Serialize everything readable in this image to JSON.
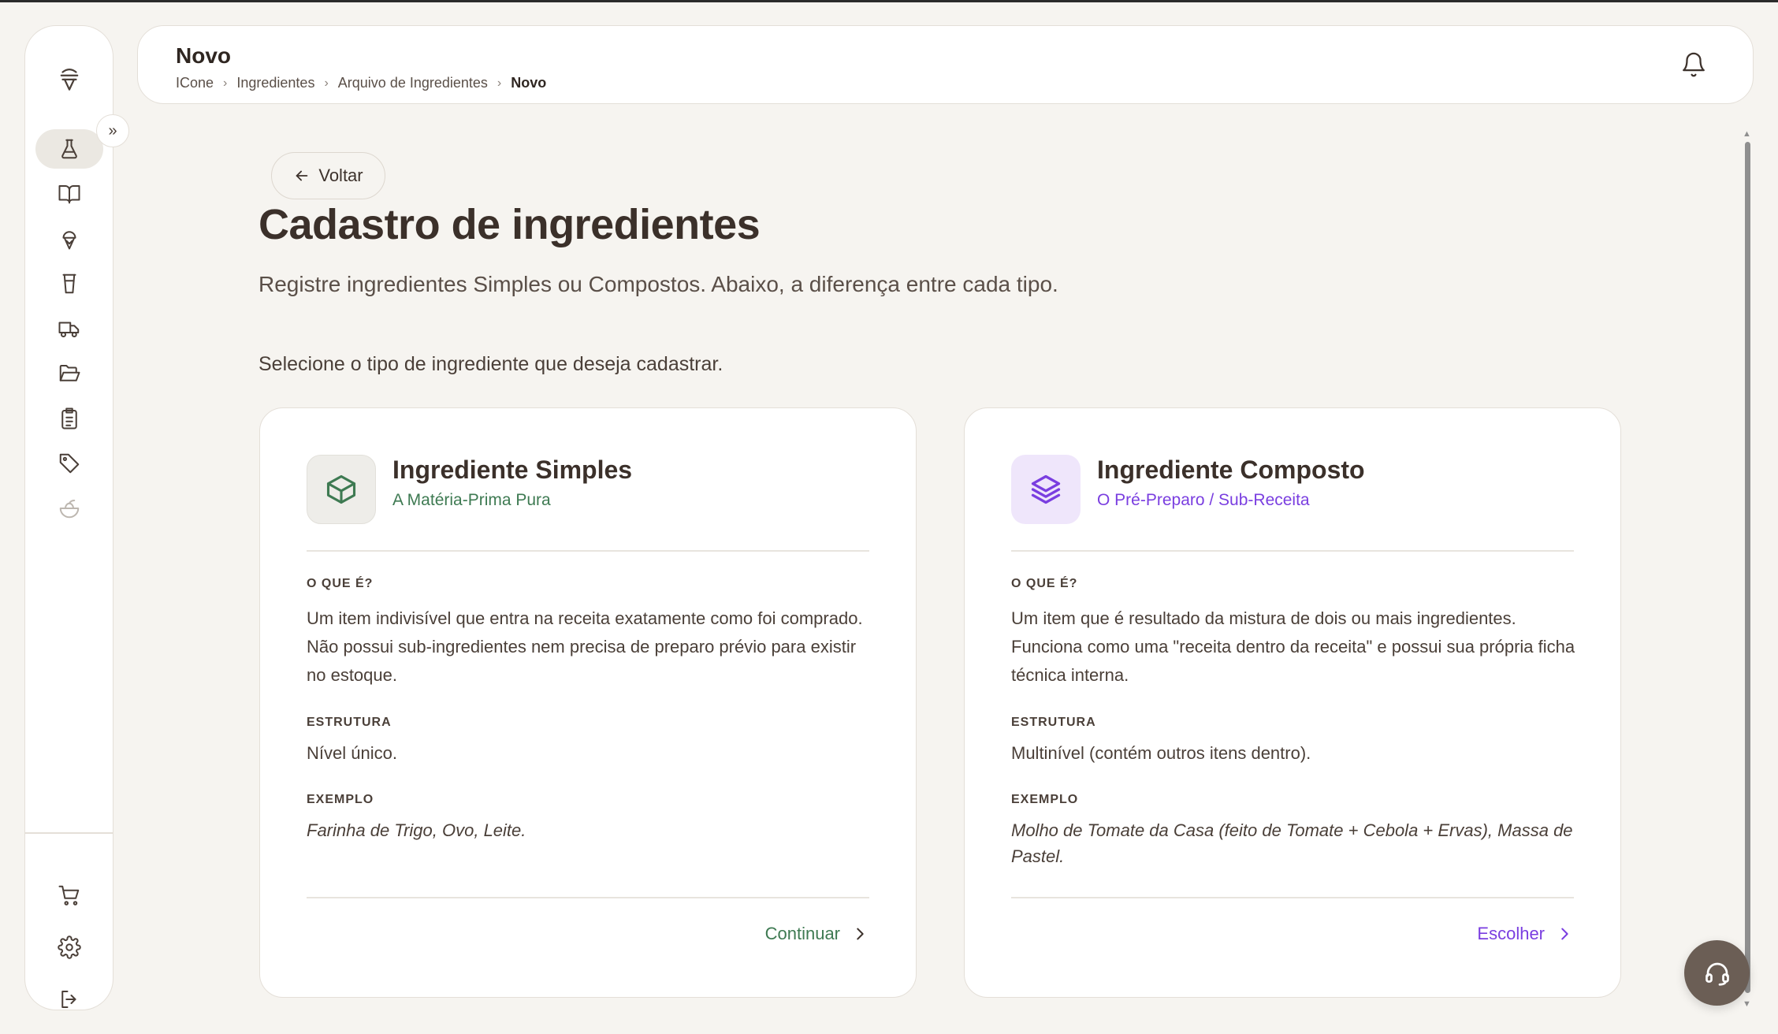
{
  "header": {
    "title": "Novo",
    "breadcrumb": [
      "ICone",
      "Ingredientes",
      "Arquivo de Ingredientes",
      "Novo"
    ]
  },
  "sidebar": {
    "items": [
      {
        "icon": "flask-icon",
        "active": true
      },
      {
        "icon": "book-icon"
      },
      {
        "icon": "ice-cream-icon"
      },
      {
        "icon": "cup-icon"
      },
      {
        "icon": "truck-icon"
      },
      {
        "icon": "folder-open-icon"
      },
      {
        "icon": "clipboard-list-icon"
      },
      {
        "icon": "tag-icon"
      },
      {
        "icon": "salad-bowl-icon"
      }
    ],
    "bottom": [
      {
        "icon": "cart-icon"
      },
      {
        "icon": "gear-icon"
      },
      {
        "icon": "logout-icon"
      }
    ]
  },
  "main": {
    "back_label": "Voltar",
    "title": "Cadastro de ingredientes",
    "subtitle": "Registre ingredientes Simples ou Compostos. Abaixo, a diferença entre cada tipo.",
    "prompt": "Selecione o tipo de ingrediente que deseja cadastrar."
  },
  "cards": {
    "simple": {
      "title": "Ingrediente Simples",
      "subtitle": "A Matéria-Prima Pura",
      "what_label": "O QUE É?",
      "what_text": "Um item indivisível que entra na receita exatamente como foi comprado. Não possui sub-ingredientes nem precisa de preparo prévio para existir no estoque.",
      "structure_label": "ESTRUTURA",
      "structure_text": "Nível único.",
      "example_label": "EXEMPLO",
      "example_text": "Farinha de Trigo, Ovo, Leite.",
      "action": "Continuar",
      "accent": "#3e7a52"
    },
    "composto": {
      "title": "Ingrediente Composto",
      "subtitle": "O Pré-Preparo / Sub-Receita",
      "what_label": "O QUE É?",
      "what_text": "Um item que é resultado da mistura de dois ou mais ingredientes. Funciona como uma \"receita dentro da receita\" e possui sua própria ficha técnica interna.",
      "structure_label": "ESTRUTURA",
      "structure_text": "Multinível (contém outros itens dentro).",
      "example_label": "EXEMPLO",
      "example_text": "Molho de Tomate da Casa (feito de Tomate + Cebola + Ervas), Massa de Pastel.",
      "action": "Escolher",
      "accent": "#7a3ee0"
    }
  }
}
